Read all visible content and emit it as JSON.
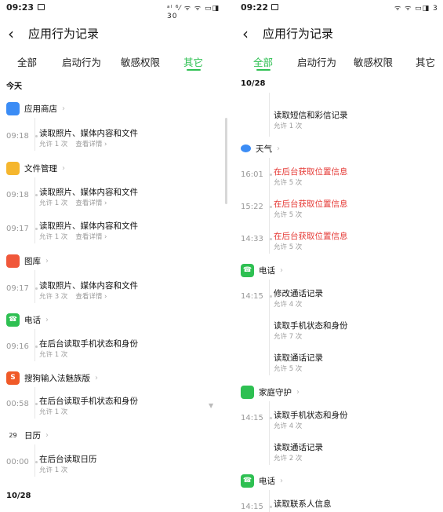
{
  "left": {
    "status": {
      "time": "09:23",
      "signal": "ᵃˡ ⁶⁄ ᯤ ᯤ ▭◨ 30"
    },
    "title": "应用行为记录",
    "tabs": [
      "全部",
      "启动行为",
      "敏感权限",
      "其它"
    ],
    "active_tab": 3,
    "date_today": "今天",
    "date_bottom": "10/28",
    "apps": [
      {
        "name": "应用商店",
        "color": "#3b8cf5",
        "icon": "shopping-bag-icon",
        "records": [
          {
            "time": "09:18",
            "action": "读取照片、媒体内容和文件",
            "allow": "允许 1 次",
            "detail": "查看详情"
          }
        ]
      },
      {
        "name": "文件管理",
        "color": "#f5b62e",
        "icon": "folder-icon",
        "records": [
          {
            "time": "09:18",
            "action": "读取照片、媒体内容和文件",
            "allow": "允许 1 次",
            "detail": "查看详情"
          },
          {
            "time": "09:17",
            "action": "读取照片、媒体内容和文件",
            "allow": "允许 1 次",
            "detail": "查看详情"
          }
        ]
      },
      {
        "name": "图库",
        "color": "#f0573a",
        "icon": "gallery-icon",
        "records": [
          {
            "time": "09:17",
            "action": "读取照片、媒体内容和文件",
            "allow": "允许 3 次",
            "detail": "查看详情"
          }
        ]
      },
      {
        "name": "电话",
        "color": "#2ec052",
        "icon": "phone-icon",
        "records": [
          {
            "time": "09:16",
            "action": "在后台读取手机状态和身份",
            "allow": "允许 1 次",
            "detail": ""
          }
        ]
      },
      {
        "name": "搜狗输入法魅族版",
        "color": "#f05a28",
        "icon": "sogou-icon",
        "records": [
          {
            "time": "00:58",
            "action": "在后台读取手机状态和身份",
            "allow": "允许 1 次",
            "detail": ""
          }
        ]
      },
      {
        "name": "日历",
        "color": "#ffffff",
        "icon": "calendar-icon",
        "icon_text": "29",
        "records": [
          {
            "time": "00:00",
            "action": "在后台读取日历",
            "allow": "允许 1 次",
            "detail": ""
          }
        ]
      }
    ]
  },
  "right": {
    "status": {
      "time": "09:22",
      "signal": "ᯤ ᯤ ▭◨ 3"
    },
    "title": "应用行为记录",
    "tabs": [
      "全部",
      "启动行为",
      "敏感权限",
      "其它"
    ],
    "active_tab": 0,
    "date_top": "10/28",
    "orphan_record": {
      "time": "",
      "action": "读取短信和彩信记录",
      "allow": "允许 1 次"
    },
    "apps": [
      {
        "name": "天气",
        "color": "#3b8cf5",
        "icon": "weather-icon",
        "records": [
          {
            "time": "16:01",
            "action": "在后台获取位置信息",
            "allow": "允许 5 次",
            "red": true
          },
          {
            "time": "15:22",
            "action": "在后台获取位置信息",
            "allow": "允许 5 次",
            "red": true
          },
          {
            "time": "14:33",
            "action": "在后台获取位置信息",
            "allow": "允许 5 次",
            "red": true
          }
        ]
      },
      {
        "name": "电话",
        "color": "#2ec052",
        "icon": "phone-icon",
        "records": [
          {
            "time": "14:15",
            "action": "修改通话记录",
            "allow": "允许 4 次"
          },
          {
            "time": "",
            "action": "读取手机状态和身份",
            "allow": "允许 7 次"
          },
          {
            "time": "",
            "action": "读取通话记录",
            "allow": "允许 5 次"
          }
        ]
      },
      {
        "name": "家庭守护",
        "color": "#2ec052",
        "icon": "family-guard-icon",
        "records": [
          {
            "time": "14:15",
            "action": "读取手机状态和身份",
            "allow": "允许 4 次"
          },
          {
            "time": "",
            "action": "读取通话记录",
            "allow": "允许 2 次"
          }
        ]
      },
      {
        "name": "电话",
        "color": "#2ec052",
        "icon": "phone-icon",
        "records": [
          {
            "time": "14:15",
            "action": "读取联系人信息",
            "allow": ""
          }
        ]
      }
    ]
  }
}
